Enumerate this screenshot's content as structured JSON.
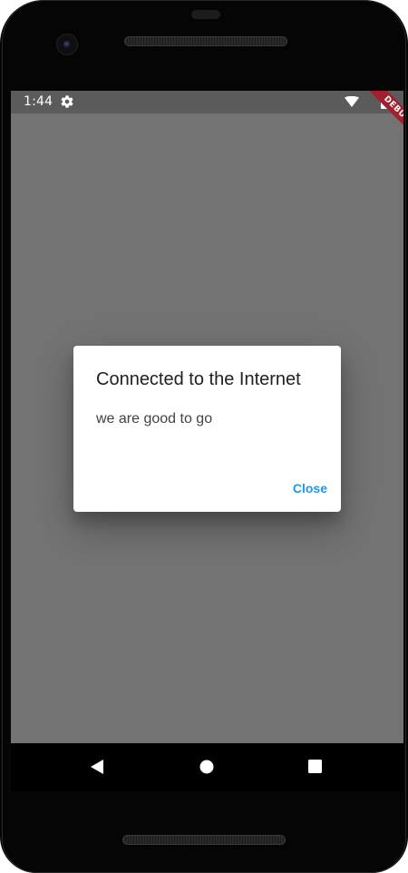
{
  "status_bar": {
    "time": "1:44",
    "settings_icon": "gear-icon",
    "wifi_icon": "wifi-icon",
    "battery_icon": "battery-icon"
  },
  "debug_banner": {
    "label": "DEBUG",
    "color": "#a0202e"
  },
  "dialog": {
    "title": "Connected to the Internet",
    "message": "we are good to go",
    "close_label": "Close",
    "accent_color": "#2196f3"
  },
  "nav_bar": {
    "back_icon": "back-triangle-icon",
    "home_icon": "home-circle-icon",
    "recents_icon": "recents-square-icon"
  },
  "colors": {
    "scrim": "#737373",
    "status_bar": "#5b5b5b",
    "device_frame": "#050505"
  }
}
